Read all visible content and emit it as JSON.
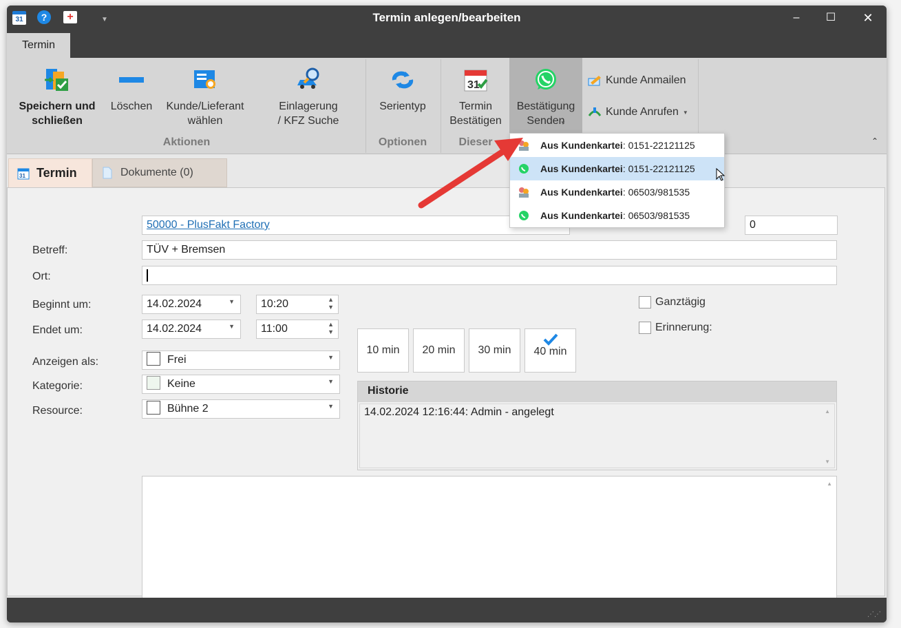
{
  "window": {
    "title": "Termin anlegen/bearbeiten"
  },
  "ribbon": {
    "tab": "Termin",
    "buttons": {
      "save": "Speichern und\nschließen",
      "delete": "Löschen",
      "customer": "Kunde/Lieferant\nwählen",
      "storage": "Einlagerung\n/ KFZ Suche",
      "series": "Serientyp",
      "confirm": "Termin\nBestätigen",
      "send": "Bestätigung\nSenden",
      "mail": "Kunde Anmailen",
      "call": "Kunde Anrufen"
    },
    "groups": {
      "actions": "Aktionen",
      "options": "Optionen",
      "this": "Dieser"
    }
  },
  "tabs": {
    "termin": "Termin",
    "documents": "Dokumente (0)"
  },
  "form": {
    "customer_link": "50000 - PlusFakt Factory",
    "number": "0",
    "subject_label": "Betreff:",
    "subject": "TÜV + Bremsen",
    "location_label": "Ort:",
    "location": "",
    "start_label": "Beginnt um:",
    "start_date": "14.02.2024",
    "start_time": "10:20",
    "end_label": "Endet um:",
    "end_date": "14.02.2024",
    "end_time": "11:00",
    "durations": [
      "10 min",
      "20 min",
      "30 min",
      "40 min"
    ],
    "selected_duration": "40 min",
    "allday_label": "Ganztägig",
    "reminder_label": "Erinnerung:",
    "show_as_label": "Anzeigen als:",
    "show_as": "Frei",
    "category_label": "Kategorie:",
    "category": "Keine",
    "resource_label": "Resource:",
    "resource": "Bühne 2"
  },
  "history": {
    "title": "Historie",
    "entries": [
      "14.02.2024 12:16:44: Admin - angelegt"
    ]
  },
  "dropdown": {
    "items": [
      {
        "bold": "Aus Kundenkartei",
        "rest": ": 0151-22121125",
        "icon": "contact-icon"
      },
      {
        "bold": "Aus Kundenkartei",
        "rest": ": 0151-22121125",
        "icon": "whatsapp-icon",
        "highlighted": true
      },
      {
        "bold": "Aus Kundenkartei",
        "rest": ": 06503/981535",
        "icon": "contact-icon"
      },
      {
        "bold": "Aus Kundenkartei",
        "rest": ": 06503/981535",
        "icon": "whatsapp-icon"
      }
    ]
  },
  "colors": {
    "accent": "#1e88e5",
    "whatsapp": "#25d366",
    "annotation": "#e53935"
  }
}
